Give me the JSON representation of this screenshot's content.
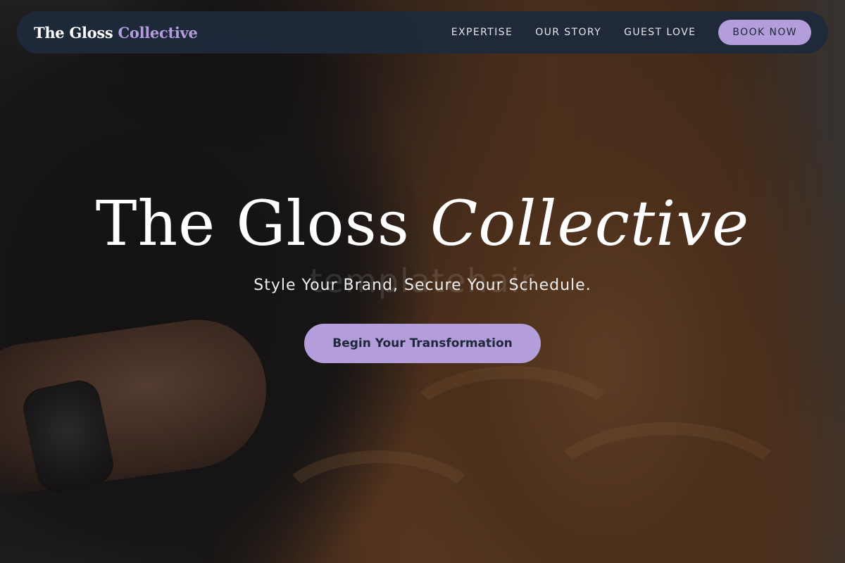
{
  "brand": {
    "name_plain": "The Gloss ",
    "name_accent": "Collective",
    "accent_color": "#b39ddb",
    "nav_bg": "#1e293b"
  },
  "nav": {
    "links": [
      {
        "label": "EXPERTISE"
      },
      {
        "label": "OUR STORY"
      },
      {
        "label": "GUEST LOVE"
      }
    ],
    "cta_label": "BOOK NOW"
  },
  "hero": {
    "title_plain": "The Gloss ",
    "title_italic": "Collective",
    "subtitle": "Style Your Brand, Secure Your Schedule.",
    "button_label": "Begin Your Transformation",
    "watermark": "templatehair",
    "background_image": "photo-of-stylist-and-wavy-brunette-balayage-hair"
  }
}
